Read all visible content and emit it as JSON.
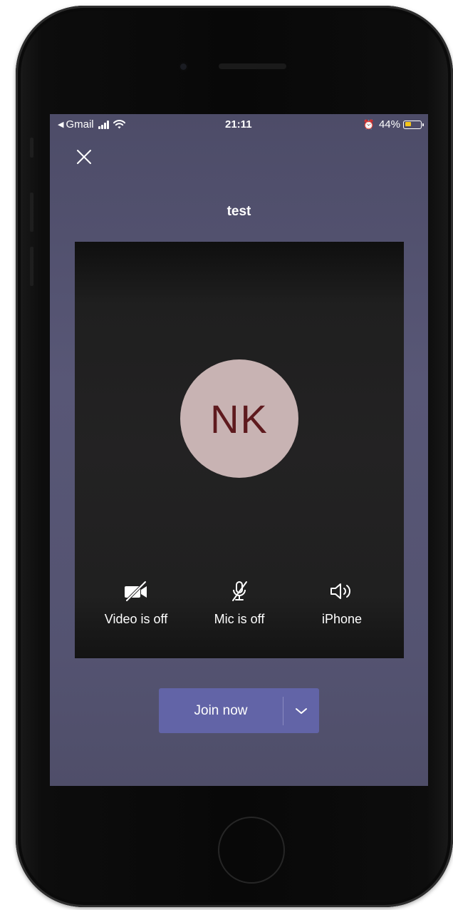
{
  "status_bar": {
    "back_app": "Gmail",
    "time": "21:11",
    "battery_percent": "44%",
    "battery_level": 0.44,
    "battery_color": "#f5c518"
  },
  "header": {
    "close_icon": "close-icon",
    "meeting_title": "test"
  },
  "preview": {
    "avatar_initials": "NK",
    "avatar_bg": "#c8b3b3",
    "avatar_text_color": "#5e1a1e",
    "controls": [
      {
        "icon": "video-off-icon",
        "label": "Video is off"
      },
      {
        "icon": "mic-off-icon",
        "label": "Mic is off"
      },
      {
        "icon": "speaker-icon",
        "label": "iPhone"
      }
    ]
  },
  "join": {
    "label": "Join now",
    "dropdown_icon": "chevron-down-icon",
    "button_color": "#6264a7"
  },
  "colors": {
    "background": "#575674"
  }
}
